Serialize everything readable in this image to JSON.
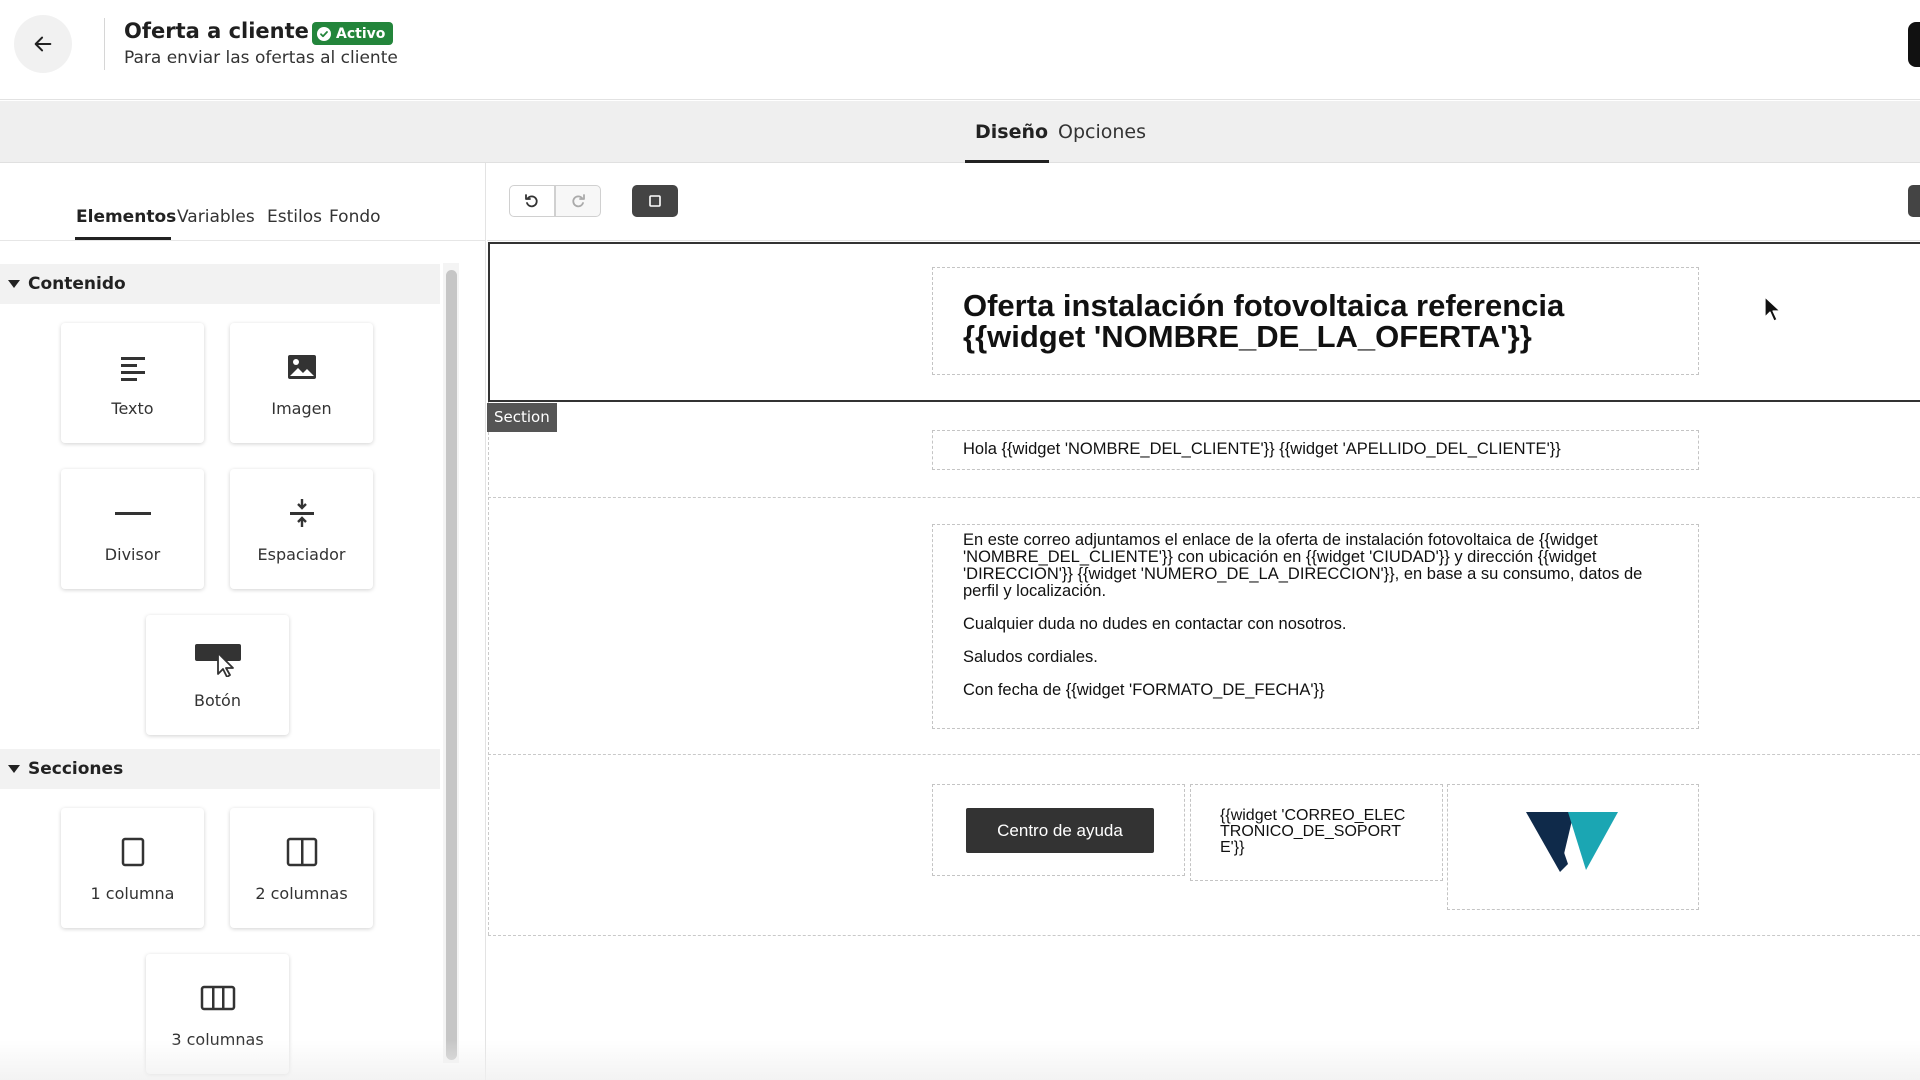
{
  "header": {
    "title": "Oferta a cliente 2",
    "status": "Activo",
    "subtitle": "Para enviar las ofertas al cliente",
    "colors": {
      "status_bg": "#23853b"
    }
  },
  "tabs": {
    "design": "Diseño",
    "options": "Opciones",
    "active": "Diseño"
  },
  "left_panel": {
    "subtabs": [
      "Elementos",
      "Variables",
      "Estilos",
      "Fondo"
    ],
    "active_subtab": "Elementos",
    "content_section": {
      "label": "Contenido",
      "items": [
        {
          "label": "Texto",
          "icon": "text-icon"
        },
        {
          "label": "Imagen",
          "icon": "image-icon"
        },
        {
          "label": "Divisor",
          "icon": "divider-icon"
        },
        {
          "label": "Espaciador",
          "icon": "spacer-icon"
        },
        {
          "label": "Botón",
          "icon": "button-icon"
        }
      ]
    },
    "sections_section": {
      "label": "Secciones",
      "items": [
        {
          "label": "1 columna",
          "icon": "one-column-icon"
        },
        {
          "label": "2 columnas",
          "icon": "two-columns-icon"
        },
        {
          "label": "3 columnas",
          "icon": "three-columns-icon"
        }
      ]
    }
  },
  "toolbar": {
    "undo_icon": "undo-icon",
    "redo_icon": "redo-icon",
    "preview_icon": "preview-icon"
  },
  "email": {
    "section_tag": "Section",
    "heading": "Oferta instalación fotovoltaica referencia {{widget 'NOMBRE_DE_LA_OFERTA'}}",
    "greeting": "Hola {{widget 'NOMBRE_DEL_CLIENTE'}} {{widget 'APELLIDO_DEL_CLIENTE'}}",
    "body": [
      "En este correo adjuntamos el enlace de la oferta de instalación fotovoltaica de {{widget 'NOMBRE_DEL_CLIENTE'}} con ubicación en {{widget 'CIUDAD'}} y dirección {{widget 'DIRECCION'}} {{widget 'NUMERO_DE_LA_DIRECCION'}}, en base a su consumo, datos de perfil y localización.",
      "Cualquier duda no dudes en contactar con nosotros.",
      "Saludos cordiales.",
      "Con fecha de {{widget 'FORMATO_DE_FECHA'}}"
    ],
    "button_label": "Centro de ayuda",
    "support_text": "{{widget 'CORREO_ELECTRONICO_DE_SOPORTE'}}",
    "logo": "company-logo-icon",
    "colors": {
      "logo_dark": "#0f2a4a",
      "logo_teal": "#1ba6b3"
    }
  }
}
